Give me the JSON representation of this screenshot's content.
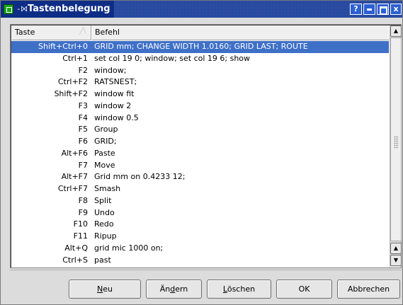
{
  "window": {
    "title": "Tastenbelegung",
    "pin_glyph": "-⨝",
    "controls": {
      "help": "?",
      "minimize": "",
      "maximize": "",
      "close": "x"
    }
  },
  "table": {
    "columns": {
      "key": "Taste",
      "command": "Befehl"
    },
    "sort_indicator": "╱\\",
    "selected_index": 0,
    "rows": [
      {
        "key": "Shift+Ctrl+0",
        "command": "GRID mm; CHANGE WIDTH 1.0160; GRID LAST; ROUTE"
      },
      {
        "key": "Ctrl+1",
        "command": "set col 19 0; window; set col 19 6; show"
      },
      {
        "key": "F2",
        "command": "window;"
      },
      {
        "key": "Ctrl+F2",
        "command": "RATSNEST;"
      },
      {
        "key": "Shift+F2",
        "command": "window fit"
      },
      {
        "key": "F3",
        "command": "window 2"
      },
      {
        "key": "F4",
        "command": "window 0.5"
      },
      {
        "key": "F5",
        "command": "Group"
      },
      {
        "key": "F6",
        "command": "GRID;"
      },
      {
        "key": "Alt+F6",
        "command": "Paste"
      },
      {
        "key": "F7",
        "command": "Move"
      },
      {
        "key": "Alt+F7",
        "command": "Grid mm on 0.4233 12;"
      },
      {
        "key": "Ctrl+F7",
        "command": "Smash"
      },
      {
        "key": "F8",
        "command": "Split"
      },
      {
        "key": "F9",
        "command": "Undo"
      },
      {
        "key": "F10",
        "command": "Redo"
      },
      {
        "key": "F11",
        "command": "Ripup"
      },
      {
        "key": "Alt+Q",
        "command": "grid mic 1000 on;"
      },
      {
        "key": "Ctrl+S",
        "command": "past"
      }
    ]
  },
  "buttons": {
    "neu": {
      "mnemonic": "N",
      "rest": "eu"
    },
    "aendern": {
      "pre": "Än",
      "mnemonic": "d",
      "rest": "ern"
    },
    "loeschen": {
      "mnemonic": "L",
      "rest": "öschen"
    },
    "ok": "OK",
    "abbrechen": "Abbrechen"
  },
  "colors": {
    "titlebar": "#1b3f9a",
    "selection": "#3f70c8",
    "app_icon": "#1aa51a"
  },
  "icons": [
    "app-icon",
    "pin-icon",
    "help-icon",
    "minimize-icon",
    "maximize-icon",
    "close-icon",
    "sort-icon",
    "scroll-up-icon",
    "scroll-down-icon"
  ]
}
